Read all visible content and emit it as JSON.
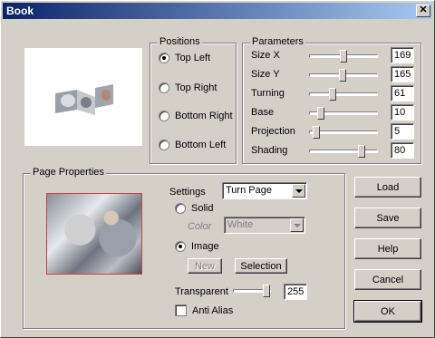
{
  "window": {
    "title": "Book",
    "close_glyph": "✕"
  },
  "positions": {
    "title": "Positions",
    "options": [
      {
        "label": "Top Left",
        "checked": true
      },
      {
        "label": "Top Right",
        "checked": false
      },
      {
        "label": "Bottom Right",
        "checked": false
      },
      {
        "label": "Bottom Left",
        "checked": false
      }
    ]
  },
  "parameters": {
    "title": "Parameters",
    "rows": [
      {
        "label": "Size X",
        "value": "169",
        "level": 0.5
      },
      {
        "label": "Size Y",
        "value": "165",
        "level": 0.48
      },
      {
        "label": "Turning",
        "value": "61",
        "level": 0.32
      },
      {
        "label": "Base",
        "value": "10",
        "level": 0.12
      },
      {
        "label": "Projection",
        "value": "5",
        "level": 0.05
      },
      {
        "label": "Shading",
        "value": "80",
        "level": 0.8
      }
    ]
  },
  "page_properties": {
    "title": "Page Properties",
    "settings_label": "Settings",
    "settings_value": "Turn Page",
    "solid_label": "Solid",
    "color_label": "Color",
    "color_value": "White",
    "image_label": "Image",
    "new_label": "New",
    "selection_label": "Selection",
    "transparent_label": "Transparent",
    "transparent_value": "255",
    "transparent_level": 1.0,
    "antialias_label": "Anti Alias"
  },
  "buttons": {
    "load": "Load",
    "save": "Save",
    "help": "Help",
    "cancel": "Cancel",
    "ok": "OK"
  }
}
